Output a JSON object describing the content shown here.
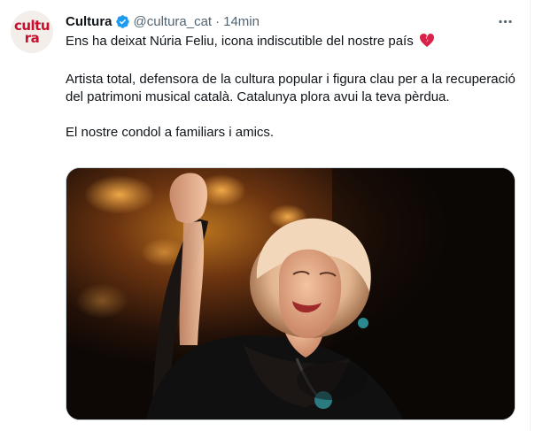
{
  "account": {
    "avatar_line1": "cultu",
    "avatar_line2": "ra",
    "name": "Cultura",
    "handle": "@cultura_cat",
    "separator": "·",
    "time": "14min"
  },
  "tweet": {
    "line1": "Ens ha deixat Núria Feliu, icona indiscutible del nostre país",
    "paragraph2": "Artista total, defensora de la cultura popular i figura clau per a la recuperació del patrimoni musical català. Catalunya plora avui la teva pèrdua.",
    "paragraph3": "El nostre condol a familiars i amics."
  },
  "icons": {
    "verified": "verified-badge-icon",
    "more": "more-options-icon",
    "heart": "broken-heart-icon"
  },
  "colors": {
    "accent": "#1d9bf0",
    "secondary_text": "#536471",
    "avatar_text": "#c8102e",
    "heart": "#d9214a"
  }
}
